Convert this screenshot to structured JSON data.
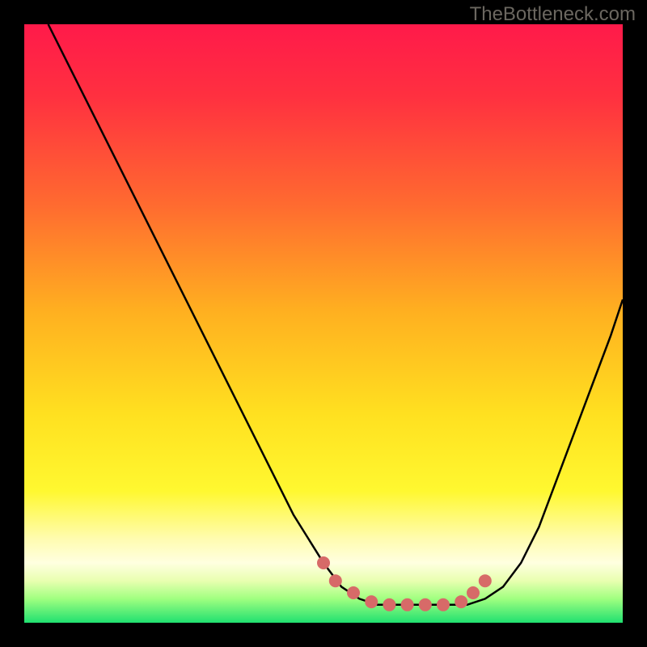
{
  "watermark": "TheBottleneck.com",
  "colors": {
    "page_bg": "#000000",
    "curve": "#000000",
    "marker_fill": "#d76a68",
    "marker_stroke": "#d76a68",
    "gradient_stops": [
      {
        "offset": "0%",
        "color": "#ff1a4a"
      },
      {
        "offset": "12%",
        "color": "#ff3040"
      },
      {
        "offset": "30%",
        "color": "#ff6a30"
      },
      {
        "offset": "48%",
        "color": "#ffb020"
      },
      {
        "offset": "65%",
        "color": "#ffe020"
      },
      {
        "offset": "78%",
        "color": "#fff830"
      },
      {
        "offset": "86%",
        "color": "#fffcb0"
      },
      {
        "offset": "90%",
        "color": "#ffffe0"
      },
      {
        "offset": "93%",
        "color": "#e8ffb0"
      },
      {
        "offset": "96%",
        "color": "#a0ff80"
      },
      {
        "offset": "100%",
        "color": "#20e070"
      }
    ]
  },
  "chart_data": {
    "type": "line",
    "title": "",
    "xlabel": "",
    "ylabel": "",
    "xlim": [
      0,
      100
    ],
    "ylim": [
      0,
      100
    ],
    "series": [
      {
        "name": "bottleneck-curve",
        "x": [
          4,
          7,
          10,
          15,
          20,
          25,
          30,
          35,
          40,
          45,
          50,
          53,
          56,
          59,
          62,
          65,
          68,
          71,
          74,
          77,
          80,
          83,
          86,
          89,
          92,
          95,
          98,
          100
        ],
        "y": [
          100,
          94,
          88,
          78,
          68,
          58,
          48,
          38,
          28,
          18,
          10,
          6,
          4,
          3,
          3,
          3,
          3,
          3,
          3,
          4,
          6,
          10,
          16,
          24,
          32,
          40,
          48,
          54
        ]
      }
    ],
    "markers": {
      "name": "highlight-points",
      "x": [
        50,
        52,
        55,
        58,
        61,
        64,
        67,
        70,
        73,
        75,
        77
      ],
      "y": [
        10,
        7,
        5,
        3.5,
        3,
        3,
        3,
        3,
        3.5,
        5,
        7
      ]
    }
  }
}
